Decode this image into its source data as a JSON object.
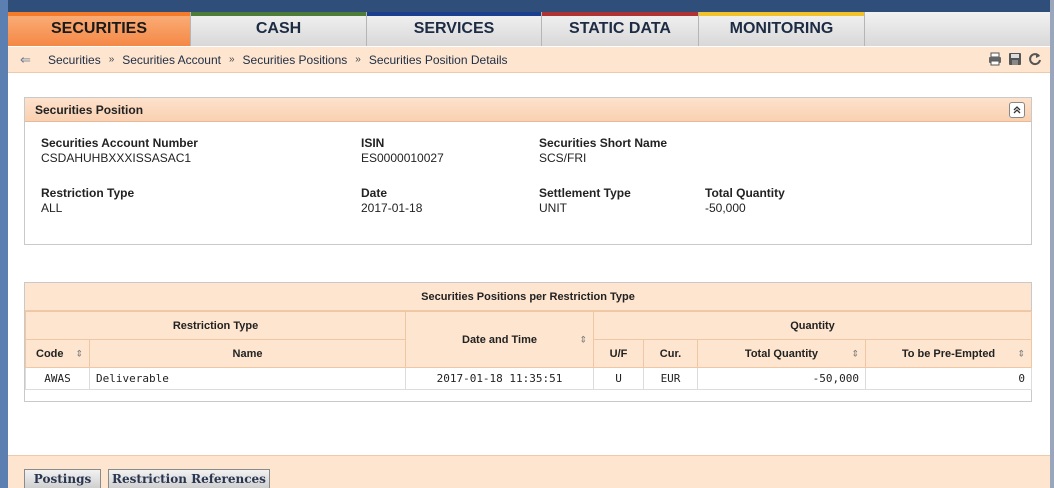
{
  "nav": {
    "tabs": [
      {
        "label": "SECURITIES",
        "accent": "#f47b2a",
        "active": true
      },
      {
        "label": "CASH",
        "accent": "#4e7d3a",
        "active": false
      },
      {
        "label": "SERVICES",
        "accent": "#1b3f8f",
        "active": false
      },
      {
        "label": "STATIC DATA",
        "accent": "#b03333",
        "active": false
      },
      {
        "label": "MONITORING",
        "accent": "#f2c22b",
        "active": false
      }
    ]
  },
  "breadcrumb": {
    "items": [
      "Securities",
      "Securities Account",
      "Securities Positions",
      "Securities Position Details"
    ],
    "separator": "»"
  },
  "icons": {
    "back": "back-arrow-icon",
    "print": "print-icon",
    "save": "save-icon",
    "refresh": "refresh-icon",
    "collapse": "collapse-icon",
    "sort": "sort-icon"
  },
  "position": {
    "title": "Securities Position",
    "fields": {
      "account_number": {
        "label": "Securities Account Number",
        "value": "CSDAHUHBXXXISSASAC1"
      },
      "isin": {
        "label": "ISIN",
        "value": "ES0000010027"
      },
      "short_name": {
        "label": "Securities Short Name",
        "value": "SCS/FRI"
      },
      "restriction_type": {
        "label": "Restriction Type",
        "value": "ALL"
      },
      "date": {
        "label": "Date",
        "value": "2017-01-18"
      },
      "settlement_type": {
        "label": "Settlement Type",
        "value": "UNIT"
      },
      "total_quantity": {
        "label": "Total Quantity",
        "value": "-50,000"
      }
    }
  },
  "table": {
    "title": "Securities Positions per Restriction Type",
    "group_headers": {
      "restriction_type": "Restriction Type",
      "date_time": "Date and Time",
      "quantity": "Quantity"
    },
    "columns": {
      "code": "Code",
      "name": "Name",
      "uf": "U/F",
      "cur": "Cur.",
      "total_quantity": "Total Quantity",
      "pre_empted": "To be Pre-Empted"
    },
    "rows": [
      {
        "code": "AWAS",
        "name": "Deliverable",
        "date_time": "2017-01-18 11:35:51",
        "uf": "U",
        "cur": "EUR",
        "total_quantity": "-50,000",
        "pre_empted": "0"
      }
    ]
  },
  "bottom_buttons": {
    "postings": "Postings",
    "restriction_references": "Restriction References"
  }
}
